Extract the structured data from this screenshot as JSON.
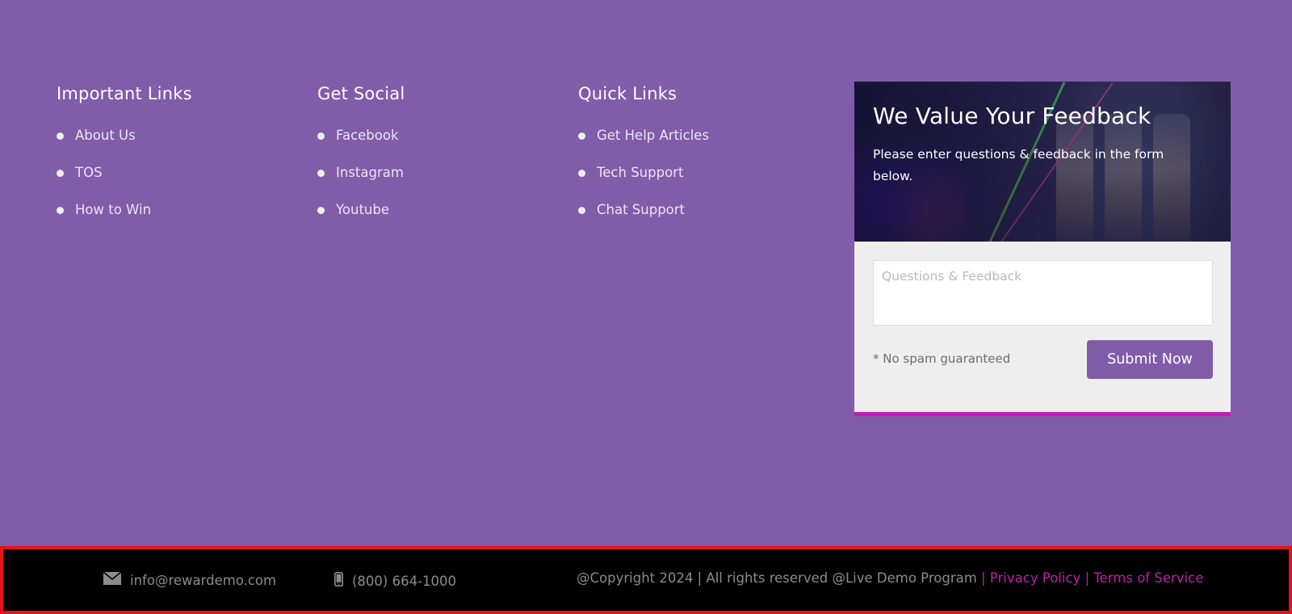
{
  "columns": [
    {
      "title": "Important Links",
      "items": [
        "About Us",
        "TOS",
        "How to Win"
      ]
    },
    {
      "title": "Get Social",
      "items": [
        "Facebook",
        "Instagram",
        "Youtube"
      ]
    },
    {
      "title": "Quick Links",
      "items": [
        "Get Help Articles",
        "Tech Support",
        "Chat Support"
      ]
    }
  ],
  "feedback": {
    "title": "We Value Your Feedback",
    "subtitle": "Please enter questions & feedback in the form below.",
    "placeholder": "Questions & Feedback",
    "note": "* No spam guaranteed",
    "submit_label": "Submit Now"
  },
  "bottom_bar": {
    "email": "info@rewardemo.com",
    "phone": "(800) 664-1000",
    "copyright": "@Copyright 2024 | All rights reserved @Live Demo Program",
    "separator": "|",
    "privacy_label": "Privacy Policy",
    "terms_label": "Terms of Service"
  },
  "icons": {
    "email": "envelope-icon",
    "phone": "mobile-phone-icon"
  },
  "colors": {
    "background": "#805ca9",
    "accent": "#c21bb2",
    "button": "#805ca9",
    "bottom_bar": "#000000",
    "highlight_border": "#e6131a"
  }
}
